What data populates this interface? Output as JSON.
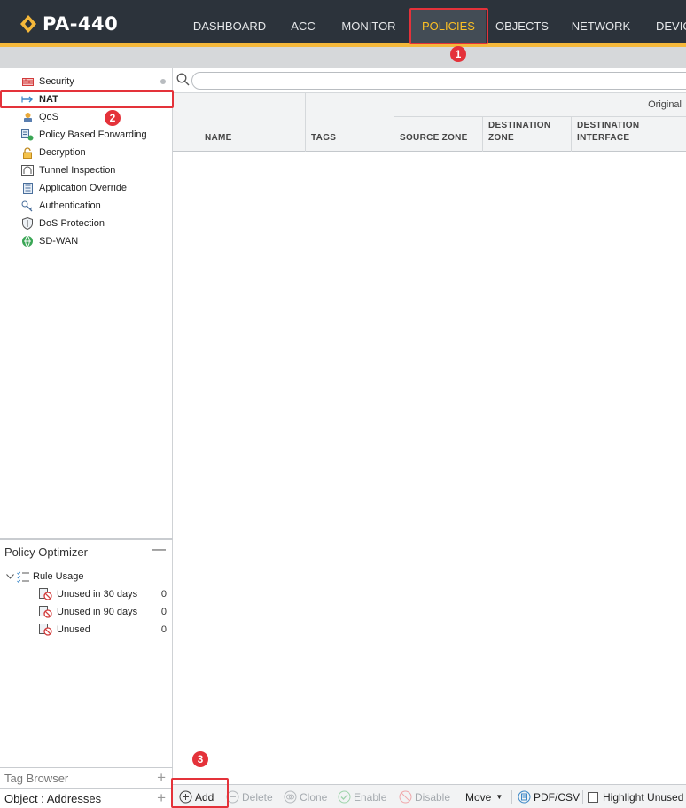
{
  "app": {
    "logo_text": "PA-440",
    "brand_color": "#f5b83a"
  },
  "nav": {
    "items": [
      {
        "label": "DASHBOARD"
      },
      {
        "label": "ACC"
      },
      {
        "label": "MONITOR"
      },
      {
        "label": "POLICIES"
      },
      {
        "label": "OBJECTS"
      },
      {
        "label": "NETWORK"
      },
      {
        "label": "DEVIC"
      }
    ],
    "active": "POLICIES"
  },
  "annotations": {
    "badge1": "1",
    "badge2": "2",
    "badge3": "3"
  },
  "sidebar": {
    "items": [
      {
        "label": "Security",
        "icon": "security-rule-icon"
      },
      {
        "label": "NAT",
        "icon": "nat-icon"
      },
      {
        "label": "QoS",
        "icon": "qos-icon"
      },
      {
        "label": "Policy Based Forwarding",
        "icon": "pbf-icon"
      },
      {
        "label": "Decryption",
        "icon": "decryption-lock-icon"
      },
      {
        "label": "Tunnel Inspection",
        "icon": "tunnel-icon"
      },
      {
        "label": "Application Override",
        "icon": "app-override-icon"
      },
      {
        "label": "Authentication",
        "icon": "authentication-icon"
      },
      {
        "label": "DoS Protection",
        "icon": "dos-shield-icon"
      },
      {
        "label": "SD-WAN",
        "icon": "sdwan-globe-icon"
      }
    ],
    "selected": "NAT"
  },
  "optimizer": {
    "title": "Policy Optimizer",
    "rule_usage_label": "Rule Usage",
    "rows": [
      {
        "label": "Unused in 30 days",
        "count": "0"
      },
      {
        "label": "Unused in 90 days",
        "count": "0"
      },
      {
        "label": "Unused",
        "count": "0"
      }
    ]
  },
  "panels": {
    "tag_browser": "Tag Browser",
    "object_browser": "Object : Addresses"
  },
  "search": {
    "value": ""
  },
  "grid": {
    "group_label": "Original",
    "columns": {
      "name": "NAME",
      "tags": "TAGS",
      "source_zone": "SOURCE ZONE",
      "dest_zone_1": "DESTINATION",
      "dest_zone_2": "ZONE",
      "dest_iface_1": "DESTINATION",
      "dest_iface_2": "INTERFACE"
    }
  },
  "toolbar": {
    "add": "Add",
    "delete": "Delete",
    "clone": "Clone",
    "enable": "Enable",
    "disable": "Disable",
    "move": "Move",
    "pdfcsv": "PDF/CSV",
    "highlight": "Highlight Unused"
  }
}
